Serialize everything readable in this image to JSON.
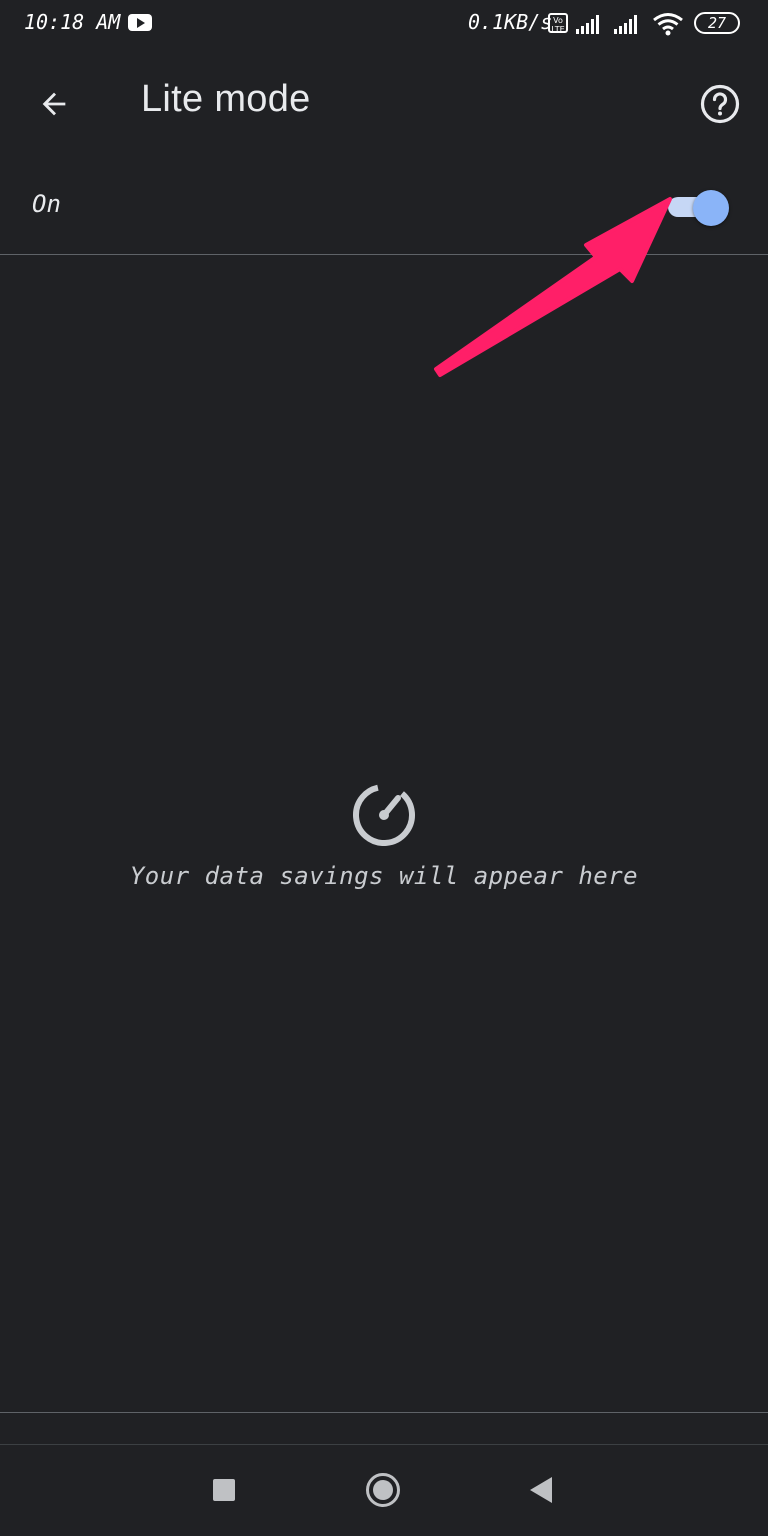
{
  "status_bar": {
    "time": "10:18 AM",
    "network_speed": "0.1KB/s",
    "volte_label": "Vo LTE",
    "battery": "27",
    "icons": [
      "youtube-notification-icon",
      "volte-icon",
      "signal-icon",
      "signal-icon",
      "wifi-icon",
      "battery-icon"
    ]
  },
  "app_bar": {
    "title": "Lite mode",
    "back_icon": "arrow-back-icon",
    "help_icon": "help-circle-icon"
  },
  "toggle": {
    "label": "On",
    "checked": true,
    "accent_color": "#8ab4f8",
    "track_color": "#c6d7f5"
  },
  "annotation": {
    "arrow_color": "#ff1f68"
  },
  "empty_state": {
    "icon": "speedometer-icon",
    "message": "Your data savings will appear here"
  },
  "nav_bar": {
    "icons": [
      "recents-square-icon",
      "home-circle-icon",
      "back-triangle-icon"
    ]
  },
  "colors": {
    "background": "#202124",
    "text": "#e8eaed",
    "divider": "#5f6368"
  }
}
